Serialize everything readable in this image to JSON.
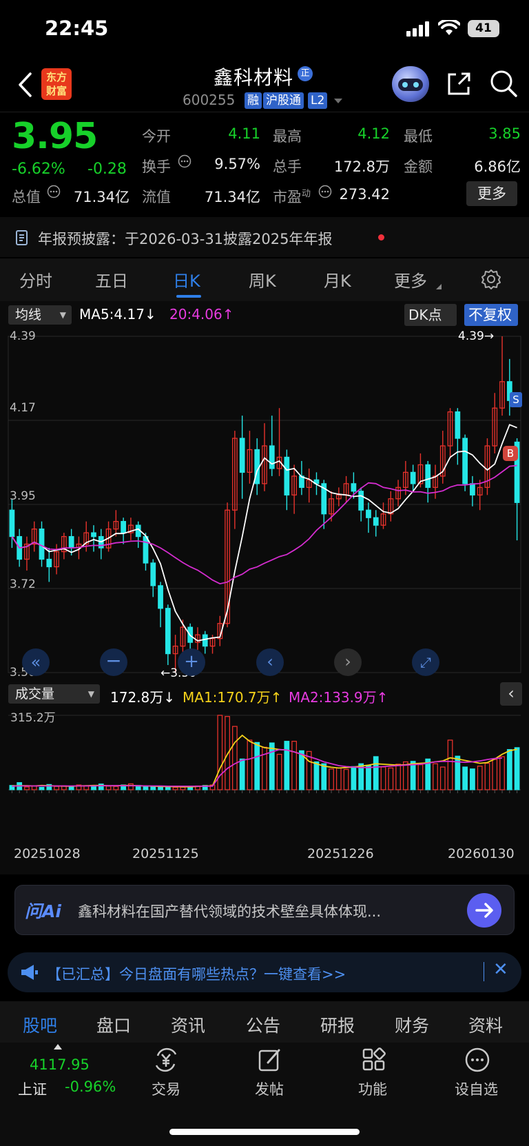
{
  "status": {
    "time": "22:45",
    "battery": "41"
  },
  "header": {
    "logo_text_1": "东方",
    "logo_text_2": "财富",
    "name": "鑫科材料",
    "name_badge": "正",
    "code": "600255",
    "tags": [
      "融",
      "沪股通",
      "L2"
    ]
  },
  "quote": {
    "price": "3.95",
    "change_pct": "-6.62%",
    "change": "-0.28",
    "fields": [
      {
        "label": "今开",
        "value": "4.11",
        "color": "#17d12a"
      },
      {
        "label": "最高",
        "value": "4.12",
        "color": "#17d12a"
      },
      {
        "label": "最低",
        "value": "3.85",
        "color": "#17d12a"
      },
      {
        "label": "换手",
        "value": "9.57%",
        "color": "#eaeaea"
      },
      {
        "label": "总手",
        "value": "172.8万",
        "color": "#eaeaea"
      },
      {
        "label": "金额",
        "value": "6.86亿",
        "color": "#eaeaea"
      },
      {
        "label": "总值",
        "value": "71.34亿",
        "color": "#eaeaea"
      },
      {
        "label": "流值",
        "value": "71.34亿",
        "color": "#eaeaea"
      },
      {
        "label": "市盈",
        "label_sup": "动",
        "value": "273.42",
        "color": "#eaeaea"
      }
    ],
    "more_label": "更多"
  },
  "notice": {
    "text": "年报预披露：于2026-03-31披露2025年年报"
  },
  "chart_tabs": [
    "分时",
    "五日",
    "日K",
    "周K",
    "月K",
    "更多"
  ],
  "active_chart_tab": "日K",
  "kline": {
    "ma_selector": "均线",
    "ma5": "MA5:4.17",
    "ma5_arrow": "↓",
    "ma20": "20:4.06",
    "ma20_arrow": "↑",
    "dk_label": "DK点",
    "fq_label": "不复权",
    "y_labels": [
      "4.39",
      "4.17",
      "3.95",
      "3.72",
      "3.50"
    ],
    "high_marker": "4.39→",
    "low_marker": "←3.50",
    "s_badge": "S",
    "b_badge": "B"
  },
  "volume": {
    "selector": "成交量",
    "vol": "172.8万",
    "vol_arrow": "↓",
    "ma1": "MA1:170.7万",
    "ma1_arrow": "↑",
    "ma2": "MA2:133.9万",
    "ma2_arrow": "↑",
    "max_label": "315.2万",
    "dates": [
      "20251028",
      "20251125",
      "20251226",
      "20260130"
    ]
  },
  "ai": {
    "logo": "问Ai",
    "text": "鑫科材料在国产替代领域的技术壁垒具体体现..."
  },
  "summary": {
    "text": "【已汇总】今日盘面有哪些热点？一键查看>>"
  },
  "bottom_tabs": [
    "股吧",
    "盘口",
    "资讯",
    "公告",
    "研报",
    "财务",
    "资料"
  ],
  "dock": {
    "index_value": "4117.95",
    "index_name": "上证",
    "index_change": "-0.96%",
    "items": [
      "交易",
      "发帖",
      "功能",
      "设自选"
    ]
  },
  "chart_data": {
    "type": "candlestick",
    "ylim": [
      3.5,
      4.39
    ],
    "candles": [
      [
        3.93,
        3.86,
        3.96,
        3.83
      ],
      [
        3.86,
        3.8,
        3.88,
        3.78
      ],
      [
        3.8,
        3.84,
        3.86,
        3.77
      ],
      [
        3.84,
        3.88,
        3.9,
        3.82
      ],
      [
        3.88,
        3.8,
        3.9,
        3.78
      ],
      [
        3.8,
        3.78,
        3.83,
        3.74
      ],
      [
        3.78,
        3.82,
        3.84,
        3.76
      ],
      [
        3.82,
        3.86,
        3.87,
        3.8
      ],
      [
        3.86,
        3.83,
        3.88,
        3.81
      ],
      [
        3.83,
        3.84,
        3.86,
        3.8
      ],
      [
        3.84,
        3.87,
        3.9,
        3.82
      ],
      [
        3.87,
        3.86,
        3.89,
        3.82
      ],
      [
        3.86,
        3.83,
        3.88,
        3.8
      ],
      [
        3.83,
        3.88,
        3.9,
        3.82
      ],
      [
        3.88,
        3.9,
        3.93,
        3.86
      ],
      [
        3.9,
        3.87,
        3.91,
        3.84
      ],
      [
        3.87,
        3.89,
        3.91,
        3.85
      ],
      [
        3.89,
        3.86,
        3.9,
        3.83
      ],
      [
        3.86,
        3.79,
        3.87,
        3.77
      ],
      [
        3.79,
        3.73,
        3.8,
        3.7
      ],
      [
        3.73,
        3.67,
        3.74,
        3.62
      ],
      [
        3.67,
        3.55,
        3.68,
        3.52
      ],
      [
        3.55,
        3.57,
        3.6,
        3.5
      ],
      [
        3.57,
        3.62,
        3.64,
        3.54
      ],
      [
        3.62,
        3.58,
        3.63,
        3.55
      ],
      [
        3.58,
        3.6,
        3.62,
        3.56
      ],
      [
        3.6,
        3.57,
        3.61,
        3.55
      ],
      [
        3.57,
        3.59,
        3.6,
        3.55
      ],
      [
        3.59,
        3.63,
        3.65,
        3.57
      ],
      [
        3.63,
        3.93,
        3.95,
        3.62
      ],
      [
        3.93,
        4.12,
        4.14,
        3.88
      ],
      [
        4.12,
        4.03,
        4.18,
        3.96
      ],
      [
        4.03,
        4.09,
        4.14,
        4.0
      ],
      [
        4.09,
        4.0,
        4.12,
        3.97
      ],
      [
        4.0,
        4.1,
        4.16,
        3.98
      ],
      [
        4.1,
        4.04,
        4.18,
        4.02
      ],
      [
        4.04,
        4.07,
        4.2,
        4.02
      ],
      [
        4.07,
        3.97,
        4.09,
        3.93
      ],
      [
        3.97,
        4.02,
        4.05,
        3.92
      ],
      [
        4.02,
        3.99,
        4.06,
        3.97
      ],
      [
        3.99,
        4.01,
        4.04,
        3.95
      ],
      [
        4.01,
        4.0,
        4.03,
        3.97
      ],
      [
        4.0,
        3.92,
        4.01,
        3.88
      ],
      [
        3.92,
        3.96,
        3.98,
        3.9
      ],
      [
        3.96,
        3.97,
        3.99,
        3.94
      ],
      [
        3.97,
        4.0,
        4.02,
        3.95
      ],
      [
        4.0,
        3.98,
        4.03,
        3.96
      ],
      [
        3.98,
        3.93,
        3.99,
        3.9
      ],
      [
        3.93,
        3.91,
        3.95,
        3.87
      ],
      [
        3.91,
        3.89,
        3.93,
        3.86
      ],
      [
        3.89,
        3.92,
        3.95,
        3.88
      ],
      [
        3.92,
        3.96,
        3.98,
        3.9
      ],
      [
        3.96,
        3.99,
        4.01,
        3.94
      ],
      [
        3.99,
        4.03,
        4.06,
        3.97
      ],
      [
        4.03,
        4.0,
        4.05,
        3.98
      ],
      [
        4.0,
        4.05,
        4.08,
        3.99
      ],
      [
        4.05,
        3.99,
        4.06,
        3.95
      ],
      [
        3.99,
        4.02,
        4.05,
        3.96
      ],
      [
        4.02,
        4.1,
        4.14,
        4.0
      ],
      [
        4.1,
        4.19,
        4.2,
        4.07
      ],
      [
        4.19,
        4.12,
        4.2,
        4.05
      ],
      [
        4.12,
        4.0,
        4.13,
        3.98
      ],
      [
        4.0,
        3.97,
        4.02,
        3.94
      ],
      [
        3.97,
        3.99,
        4.01,
        3.93
      ],
      [
        3.99,
        4.1,
        4.12,
        3.97
      ],
      [
        4.1,
        4.2,
        4.24,
        4.08
      ],
      [
        4.2,
        4.27,
        4.39,
        4.18
      ],
      [
        4.27,
        4.22,
        4.33,
        4.18
      ],
      [
        4.11,
        3.95,
        4.12,
        3.85
      ]
    ],
    "volumes": [
      18,
      30,
      12,
      16,
      10,
      22,
      14,
      17,
      12,
      20,
      16,
      18,
      24,
      15,
      14,
      20,
      25,
      18,
      15,
      12,
      12,
      14,
      10,
      11,
      12,
      16,
      18,
      20,
      315,
      310,
      268,
      130,
      210,
      200,
      180,
      198,
      150,
      205,
      205,
      165,
      162,
      118,
      110,
      88,
      92,
      86,
      98,
      110,
      102,
      140,
      96,
      92,
      108,
      118,
      120,
      106,
      130,
      110,
      96,
      210,
      142,
      96,
      88,
      100,
      112,
      128,
      140,
      170,
      178
    ],
    "ma1_volume": [
      16,
      17,
      17,
      16,
      18,
      17,
      16,
      15,
      15,
      16,
      17,
      18,
      18,
      17,
      17,
      18,
      18,
      17,
      16,
      15,
      14,
      13,
      13,
      12,
      12,
      14,
      16,
      16,
      90,
      150,
      200,
      230,
      205,
      190,
      178,
      175,
      170,
      168,
      160,
      150,
      120,
      110,
      100,
      95,
      92,
      94,
      96,
      100,
      104,
      110,
      108,
      106,
      104,
      106,
      110,
      112,
      114,
      118,
      122,
      135,
      130,
      124,
      118,
      112,
      115,
      130,
      150,
      165,
      171
    ],
    "ma2_volume": [
      15,
      16,
      16,
      16,
      16,
      16,
      16,
      16,
      16,
      16,
      16,
      16,
      17,
      17,
      17,
      17,
      17,
      17,
      16,
      16,
      16,
      15,
      15,
      15,
      15,
      15,
      15,
      15,
      60,
      90,
      110,
      125,
      130,
      140,
      150,
      160,
      170,
      168,
      160,
      150,
      140,
      130,
      118,
      110,
      102,
      98,
      96,
      94,
      94,
      96,
      98,
      100,
      102,
      104,
      106,
      108,
      112,
      118,
      120,
      120,
      118,
      116,
      118,
      122,
      128,
      132,
      134
    ]
  }
}
